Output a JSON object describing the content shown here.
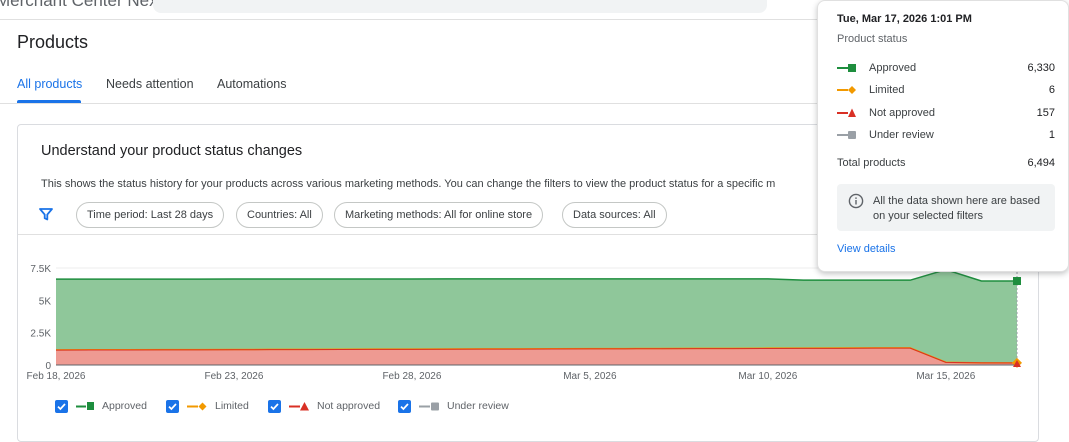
{
  "header": {
    "app_name": "Merchant Center Next"
  },
  "page": {
    "title": "Products"
  },
  "tabs": [
    {
      "label": "All products",
      "active": true
    },
    {
      "label": "Needs attention",
      "active": false
    },
    {
      "label": "Automations",
      "active": false
    }
  ],
  "card": {
    "title": "Understand your product status changes",
    "description": "This shows the status history for your products across various marketing methods. You can change the filters to view the product status for a specific m",
    "filters": [
      {
        "label": "Time period: Last 28 days"
      },
      {
        "label": "Countries: All"
      },
      {
        "label": "Marketing methods: All for online store"
      },
      {
        "label": "Data sources: All"
      }
    ]
  },
  "colors": {
    "approved": "#1e8e3e",
    "approved_fill": "#8fc79a",
    "limited": "#f29900",
    "not_approved": "#d93025",
    "not_approved_fill": "#ee9a92",
    "under_review": "#9aa0a6",
    "accent": "#1a73e8"
  },
  "legend": [
    {
      "label": "Approved",
      "icon": "square-marker-icon",
      "color": "#1e8e3e"
    },
    {
      "label": "Limited",
      "icon": "diamond-marker-icon",
      "color": "#f29900"
    },
    {
      "label": "Not approved",
      "icon": "triangle-marker-icon",
      "color": "#d93025"
    },
    {
      "label": "Under review",
      "icon": "square-marker-icon",
      "color": "#9aa0a6"
    }
  ],
  "tooltip": {
    "date": "Tue, Mar 17, 2026 1:01 PM",
    "subtitle": "Product status",
    "rows": [
      {
        "label": "Approved",
        "value": "6,330"
      },
      {
        "label": "Limited",
        "value": "6"
      },
      {
        "label": "Not approved",
        "value": "157"
      },
      {
        "label": "Under review",
        "value": "1"
      }
    ],
    "total_label": "Total products",
    "total_value": "6,494",
    "info_text": "All the data shown here are based on your selected filters",
    "link": "View details"
  },
  "chart_data": {
    "type": "area",
    "stacked": true,
    "x_tick_labels": [
      "Feb 18, 2026",
      "Feb 23, 2026",
      "Feb 28, 2026",
      "Mar 5, 2026",
      "Mar 10, 2026",
      "Mar 15, 2026"
    ],
    "y_tick_labels": [
      "0",
      "2.5K",
      "5K",
      "7.5K"
    ],
    "ylim": [
      0,
      7500
    ],
    "x": [
      "Feb 18",
      "Feb 19",
      "Feb 20",
      "Feb 21",
      "Feb 22",
      "Feb 23",
      "Feb 24",
      "Feb 25",
      "Feb 26",
      "Feb 27",
      "Feb 28",
      "Mar 1",
      "Mar 2",
      "Mar 3",
      "Mar 4",
      "Mar 5",
      "Mar 6",
      "Mar 7",
      "Mar 8",
      "Mar 9",
      "Mar 10",
      "Mar 11",
      "Mar 12",
      "Mar 13",
      "Mar 14",
      "Mar 15",
      "Mar 16",
      "Mar 17"
    ],
    "series": [
      {
        "name": "Under review",
        "values": [
          0,
          0,
          0,
          0,
          0,
          0,
          0,
          0,
          0,
          0,
          0,
          0,
          0,
          0,
          0,
          0,
          0,
          0,
          0,
          0,
          0,
          0,
          0,
          0,
          0,
          2,
          1,
          1
        ]
      },
      {
        "name": "Not approved",
        "values": [
          1150,
          1155,
          1160,
          1165,
          1170,
          1180,
          1185,
          1190,
          1200,
          1205,
          1210,
          1220,
          1225,
          1230,
          1240,
          1245,
          1250,
          1260,
          1265,
          1270,
          1280,
          1285,
          1290,
          1300,
          1300,
          200,
          160,
          157
        ]
      },
      {
        "name": "Limited",
        "values": [
          20,
          20,
          20,
          20,
          20,
          20,
          20,
          20,
          20,
          20,
          20,
          20,
          20,
          20,
          20,
          20,
          20,
          20,
          20,
          20,
          20,
          20,
          20,
          20,
          20,
          10,
          6,
          6
        ]
      },
      {
        "name": "Approved",
        "values": [
          5470,
          5465,
          5460,
          5455,
          5450,
          5445,
          5440,
          5435,
          5430,
          5425,
          5420,
          5415,
          5410,
          5405,
          5400,
          5395,
          5390,
          5380,
          5375,
          5370,
          5360,
          5255,
          5250,
          5240,
          5240,
          7160,
          6330,
          6330
        ]
      }
    ]
  }
}
